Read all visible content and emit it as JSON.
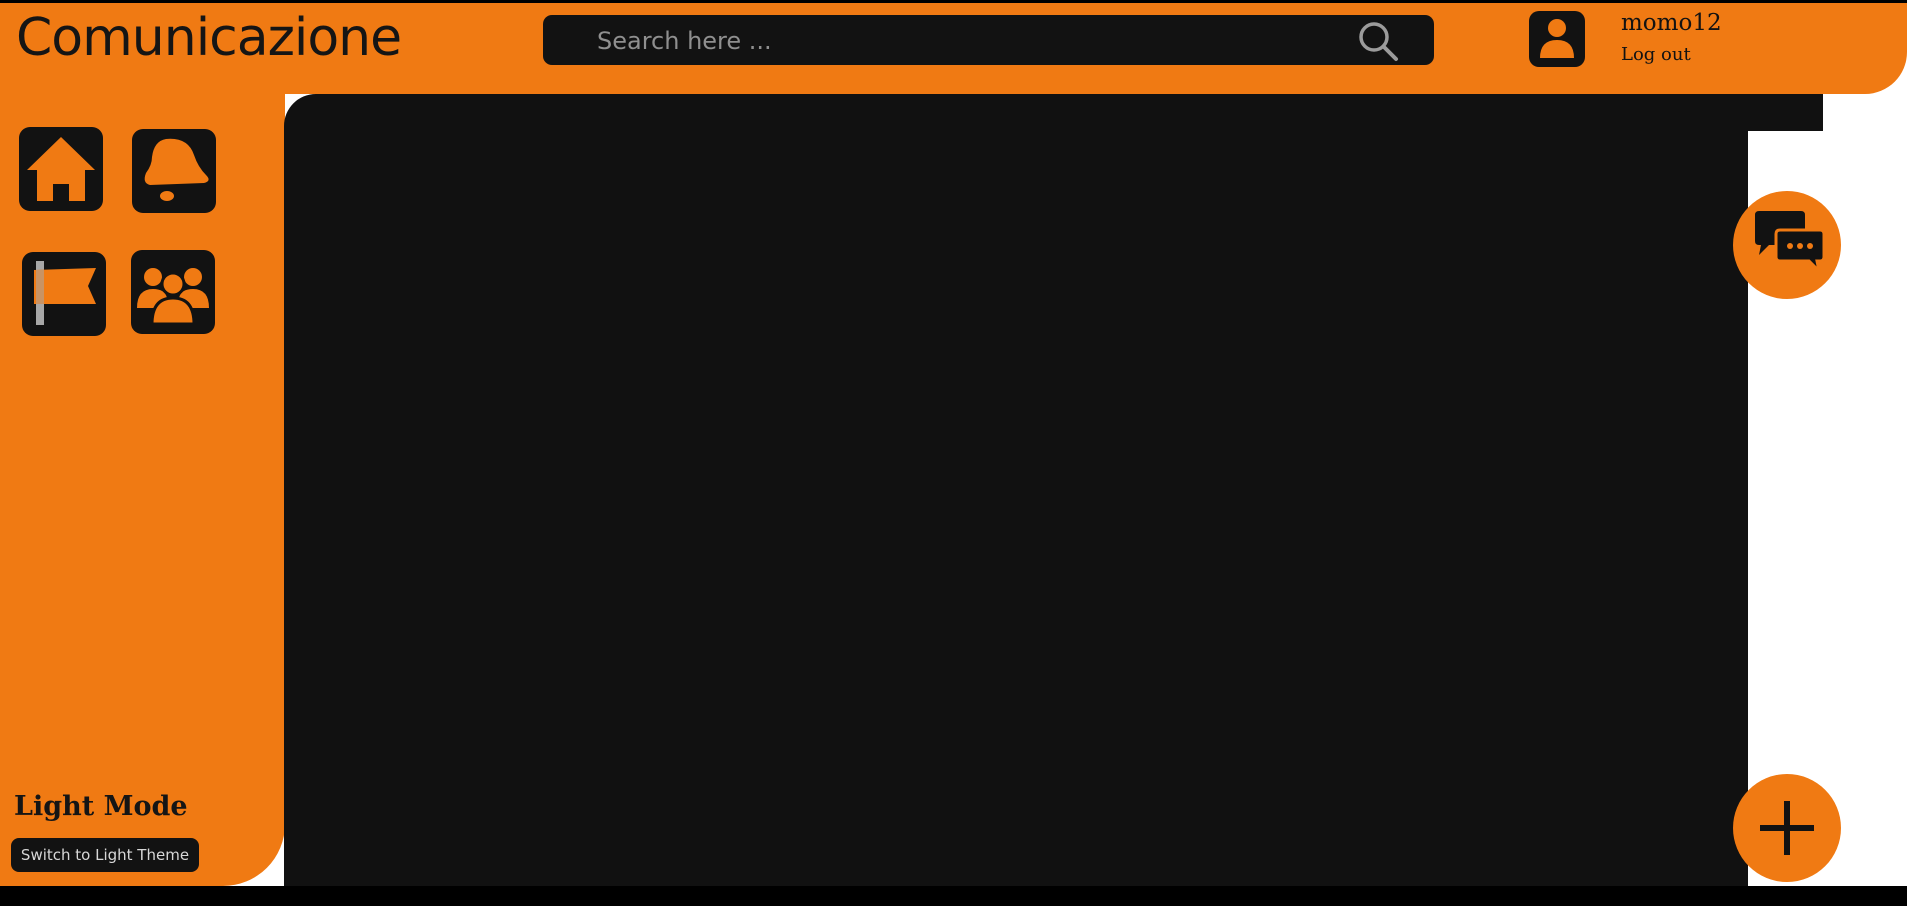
{
  "header": {
    "app_title": "Comunicazione",
    "search_placeholder": "Search here ...",
    "search_icon": "search-icon"
  },
  "user": {
    "username": "momo12",
    "logout_label": "Log out",
    "avatar_icon": "user-icon"
  },
  "sidebar": {
    "nav": [
      {
        "name": "home",
        "icon": "home-icon"
      },
      {
        "name": "notifications",
        "icon": "bell-icon"
      },
      {
        "name": "reports",
        "icon": "flag-icon"
      },
      {
        "name": "groups",
        "icon": "group-icon"
      }
    ],
    "mode_title": "Light Mode",
    "theme_button_label": "Switch to Light Theme"
  },
  "fabs": {
    "chat_icon": "chat-bubbles-icon",
    "add_icon": "plus-icon"
  },
  "colors": {
    "accent": "#f07a13",
    "dark": "#121212",
    "main_bg": "#111111"
  }
}
